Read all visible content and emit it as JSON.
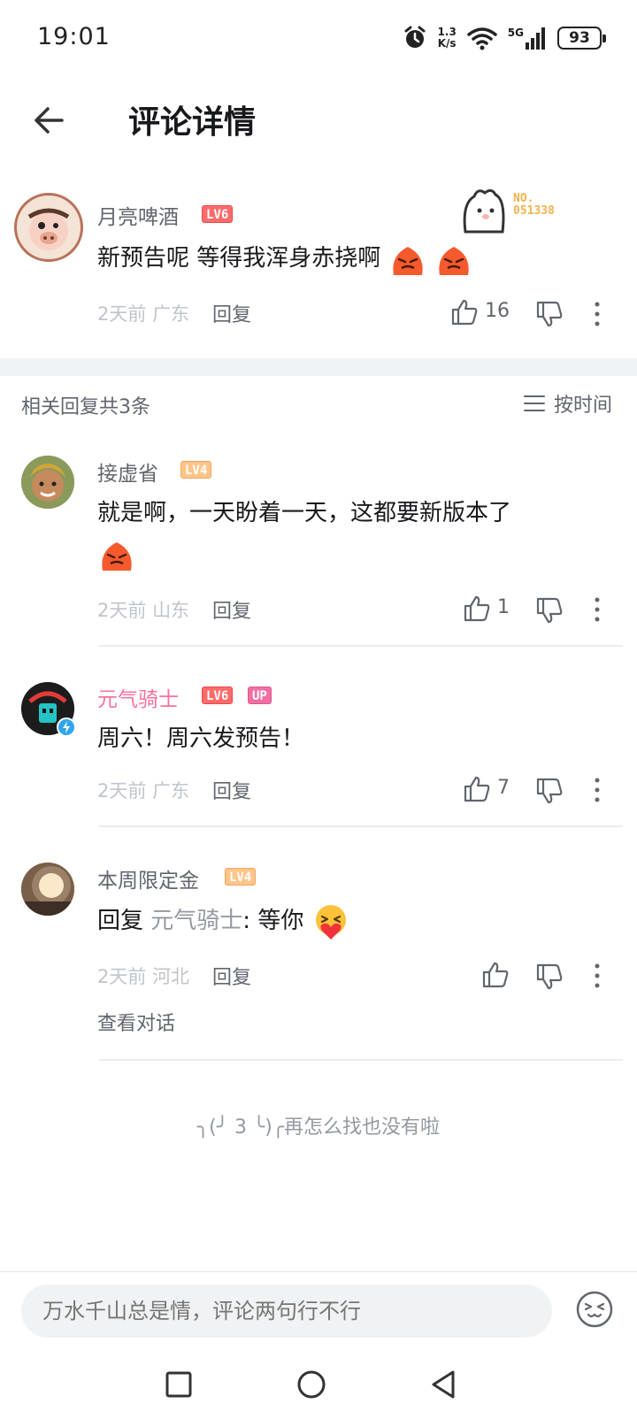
{
  "status_bar": {
    "time": "19:01",
    "net_speed_value": "1.3",
    "net_speed_unit": "K/s",
    "network": "5G",
    "battery": "93"
  },
  "header": {
    "title": "评论详情"
  },
  "main_comment": {
    "username": "月亮啤酒",
    "level": "LV6",
    "text": "新预告呢 等得我浑身赤挠啊",
    "emojis": [
      "angry-blob",
      "angry-blob"
    ],
    "time": "2天前",
    "location": "广东",
    "reply_label": "回复",
    "likes": "16",
    "sticker_label": "NO.",
    "sticker_number": "051338"
  },
  "replies_header": {
    "count_text": "相关回复共3条",
    "sort_label": "按时间"
  },
  "replies": [
    {
      "username": "接虚省",
      "level": "LV4",
      "text_line1": "就是啊，一天盼着一天，这都要新版本了",
      "emoji": "angry-blob",
      "time": "2天前",
      "location": "山东",
      "reply_label": "回复",
      "likes": "1"
    },
    {
      "username": "元气骑士",
      "level": "LV6",
      "badge": "UP",
      "text": "周六！周六发预告！",
      "time": "2天前",
      "location": "广东",
      "reply_label": "回复",
      "likes": "7"
    },
    {
      "username": "本周限定金",
      "level": "LV4",
      "reply_prefix": "回复",
      "reply_target": "元气骑士",
      "text": ": 等你",
      "emoji": "heart-hug-face",
      "time": "2天前",
      "location": "河北",
      "reply_label": "回复",
      "view_dialog": "查看对话"
    }
  ],
  "end_hint": "╮(╯ 3 ╰)╭再怎么找也没有啦",
  "bottom_bar": {
    "input_placeholder": "万水千山总是情，评论两句行不行"
  },
  "colors": {
    "accent_pink": "#fb7299",
    "lv6": "#ff6b6b",
    "lv4": "#ffc58a"
  }
}
